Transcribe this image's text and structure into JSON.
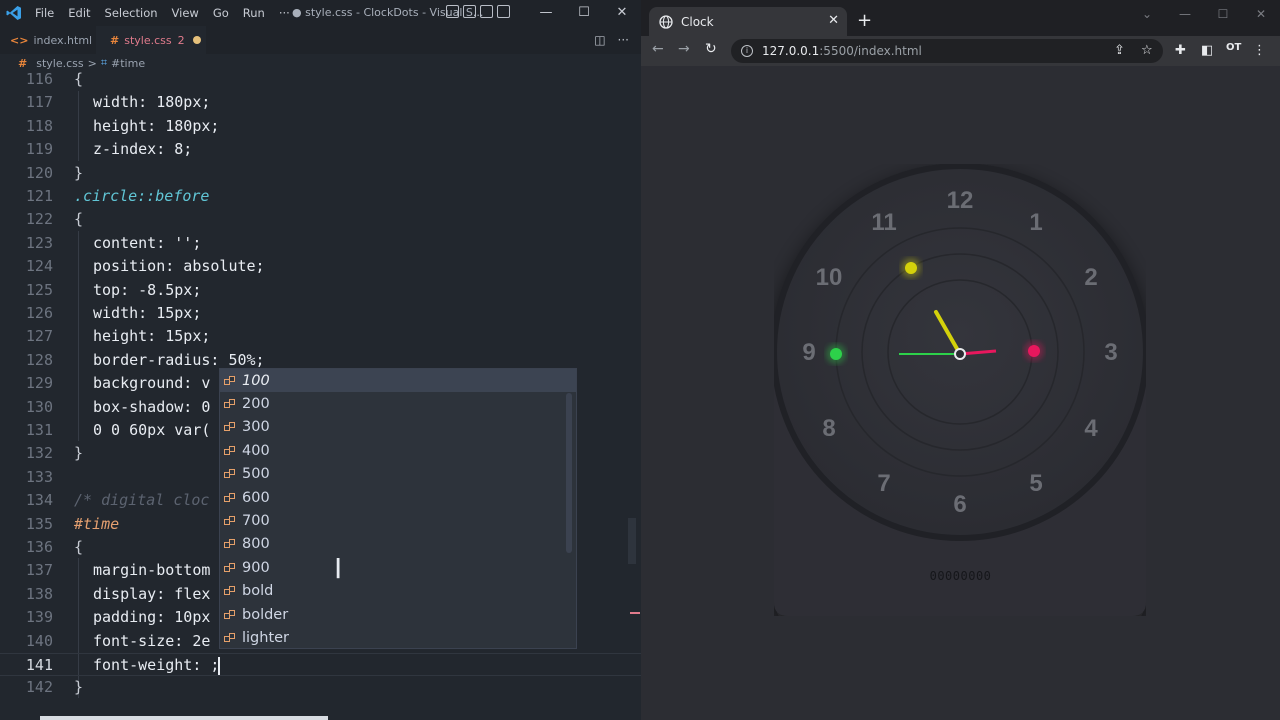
{
  "vscode": {
    "menu": [
      "File",
      "Edit",
      "Selection",
      "View",
      "Go",
      "Run",
      "···"
    ],
    "title": "● style.css - ClockDots - Visual S...",
    "tabs": [
      {
        "label": "index.html",
        "icon": "html-icon"
      },
      {
        "label": "style.css",
        "count": "2",
        "icon": "css-icon",
        "modified": true
      }
    ],
    "breadcrumb": {
      "file": "style.css",
      "sep": ">",
      "symbol": "#time"
    },
    "lines": [
      {
        "num": "116",
        "text": "{"
      },
      {
        "num": "117",
        "text": "width: 180px;"
      },
      {
        "num": "118",
        "text": "height: 180px;"
      },
      {
        "num": "119",
        "text": "z-index: 8;"
      },
      {
        "num": "120",
        "text": "}"
      },
      {
        "num": "121",
        "text": ".circle::before"
      },
      {
        "num": "122",
        "text": "{"
      },
      {
        "num": "123",
        "text": "content: '';"
      },
      {
        "num": "124",
        "text": "position: absolute;"
      },
      {
        "num": "125",
        "text": "top: -8.5px;"
      },
      {
        "num": "126",
        "text": "width: 15px;"
      },
      {
        "num": "127",
        "text": "height: 15px;"
      },
      {
        "num": "128",
        "text": "border-radius: 50%;"
      },
      {
        "num": "129",
        "text": "background: v"
      },
      {
        "num": "130",
        "text": "box-shadow: 0"
      },
      {
        "num": "131",
        "text": "0 0 60px var("
      },
      {
        "num": "132",
        "text": "}"
      },
      {
        "num": "133",
        "text": ""
      },
      {
        "num": "134",
        "text": "/* digital cloc"
      },
      {
        "num": "135",
        "text": "#time"
      },
      {
        "num": "136",
        "text": "{"
      },
      {
        "num": "137",
        "text": "margin-bottom"
      },
      {
        "num": "138",
        "text": "display: flex"
      },
      {
        "num": "139",
        "text": "padding: 10px"
      },
      {
        "num": "140",
        "text": "font-size: 2e"
      },
      {
        "num": "141",
        "text": "font-weight: ;"
      },
      {
        "num": "142",
        "text": "}"
      }
    ],
    "suggestions": [
      "100",
      "200",
      "300",
      "400",
      "500",
      "600",
      "700",
      "800",
      "900",
      "bold",
      "bolder",
      "lighter"
    ]
  },
  "browser": {
    "tab_title": "Clock",
    "url_host": "127.0.0.1",
    "url_rest": ":5500/index.html",
    "profile": "OT"
  },
  "clock": {
    "numbers": [
      "12",
      "1",
      "2",
      "3",
      "4",
      "5",
      "6",
      "7",
      "8",
      "9",
      "10",
      "11"
    ],
    "digital_time": "00000000",
    "colors": {
      "hour": "#d4d10b",
      "minute": "#2dd14a",
      "second": "#e8175d"
    }
  }
}
